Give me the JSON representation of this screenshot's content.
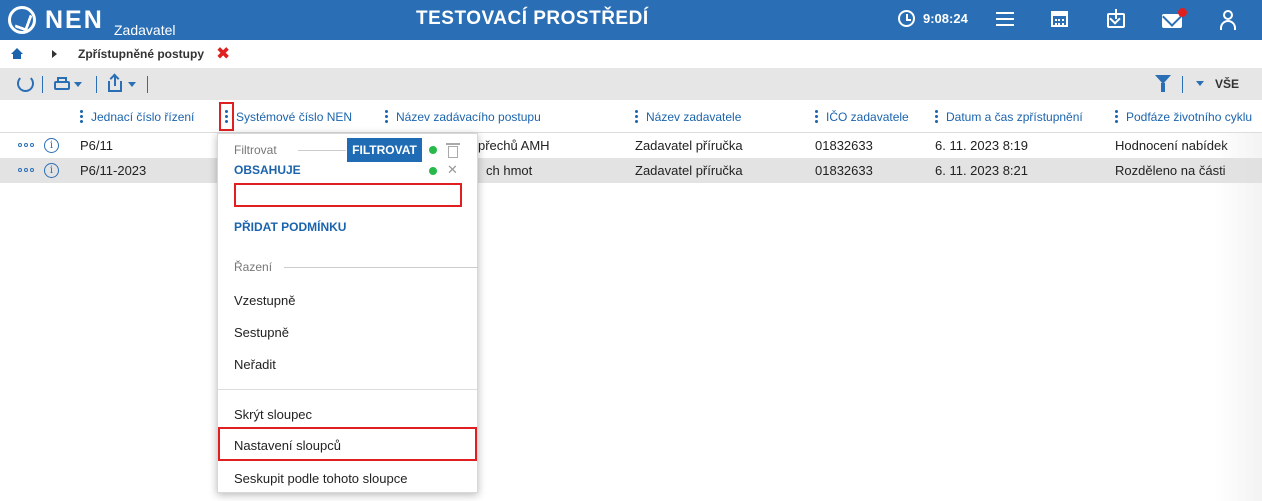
{
  "topbar": {
    "logo_text": "NEN",
    "logo_sub": "Zadavatel",
    "env_title": "TESTOVACÍ PROSTŘEDÍ",
    "clock_time": "9:08:24",
    "icons": [
      "clock-icon",
      "menu-icon",
      "calculator-icon",
      "inbox-icon",
      "mail-icon",
      "user-icon"
    ],
    "notification_color": "#e02020",
    "bar_color": "#2a6fb5"
  },
  "breadcrumb": {
    "label": "Zpřístupněné postupy",
    "close": "✖"
  },
  "toolbar": {
    "filter_scope": "VŠE"
  },
  "table": {
    "columns": [
      "Jednací číslo řízení",
      "Systémové číslo NEN",
      "Název zadávacího postupu",
      "Název zadavatele",
      "IČO zadavatele",
      "Datum a čas zpřístupnění",
      "Podfáze životního cyklu"
    ],
    "rows": [
      {
        "cislo": "P6/11",
        "nazev_postupu": "přechů AMH",
        "zadavatel": "Zadavatel příručka",
        "ico": "01832633",
        "datum": "6. 11. 2023 8:19",
        "podfaze": "Hodnocení nabídek"
      },
      {
        "cislo": "P6/11-2023",
        "nazev_postupu": "ch hmot",
        "zadavatel": "Zadavatel příručka",
        "ico": "01832633",
        "datum": "6. 11. 2023 8:21",
        "podfaze": "Rozděleno na části"
      }
    ]
  },
  "dropdown": {
    "filter_section": "Filtrovat",
    "filter_button": "FILTROVAT",
    "operator": "OBSAHUJE",
    "filter_value": "",
    "add_condition": "PŘIDAT PODMÍNKU",
    "sort_section": "Řazení",
    "sort_asc": "Vzestupně",
    "sort_desc": "Sestupně",
    "sort_none": "Neřadit",
    "hide_column": "Skrýt sloupec",
    "column_settings": "Nastavení sloupců",
    "group_by": "Seskupit podle tohoto sloupce",
    "status_color": "#29b94a",
    "highlight_color": "#e02020"
  }
}
